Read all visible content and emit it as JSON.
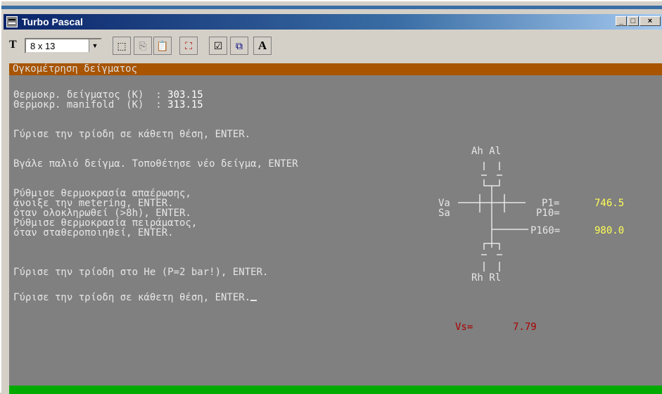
{
  "window": {
    "title": "Turbo Pascal",
    "buttons": [
      "_",
      "□",
      "×"
    ]
  },
  "toolbar": {
    "font_icon": "truetype-font-icon",
    "font_size": "8 x 13",
    "buttons": [
      {
        "name": "mark-icon",
        "glyph": "⬚"
      },
      {
        "name": "copy-icon",
        "glyph": "⎘"
      },
      {
        "name": "paste-icon",
        "glyph": "📋"
      },
      {
        "name": "fullscreen-icon",
        "glyph": "⛶"
      },
      {
        "name": "properties-icon",
        "glyph": "☑"
      },
      {
        "name": "background-icon",
        "glyph": "⧉"
      },
      {
        "name": "font-icon",
        "glyph": "A"
      }
    ]
  },
  "console": {
    "header": "Ογκομέτρηση δείγματος",
    "temp_sample_label": "Θερμοκρ. δείγματος (K)  : ",
    "temp_sample_value": "303.15",
    "temp_manifold_label": "Θερμοκρ. manifold  (K)  : ",
    "temp_manifold_value": "313.15",
    "lines": [
      "Γύρισε την τρίοδη σε κάθετη θέση, ENTER.",
      "Βγάλε παλιό δείγμα. Τοποθέτησε νέο δείγμα, ENTER",
      "Ρύθμισε θερμοκρασία απαέρωσης,",
      "άνοιξε την metering, ENTER.",
      "όταν ολοκληρωθεί (>8h), ENTER.",
      "Ρύθμισε θερμοκρασία πειράματος,",
      "όταν σταθεροποιηθεί, ENTER.",
      "Γύρισε την τρίοδη στο He (P=2 bar!), ENTER.",
      "Γύρισε την τρίοδη σε κάθετη θέση, ENTER."
    ],
    "diagram": {
      "label_ah_al": "Ah Al",
      "label_va": "Va",
      "label_sa": "Sa",
      "label_rh_rl": "Rh Rl",
      "p1_label": "P1=",
      "p1_value": "746.5",
      "p10_label": "P10=",
      "p160_label": "P160=",
      "p160_value": "980.0"
    },
    "vs_label": "Vs=",
    "vs_value": "7.79"
  }
}
